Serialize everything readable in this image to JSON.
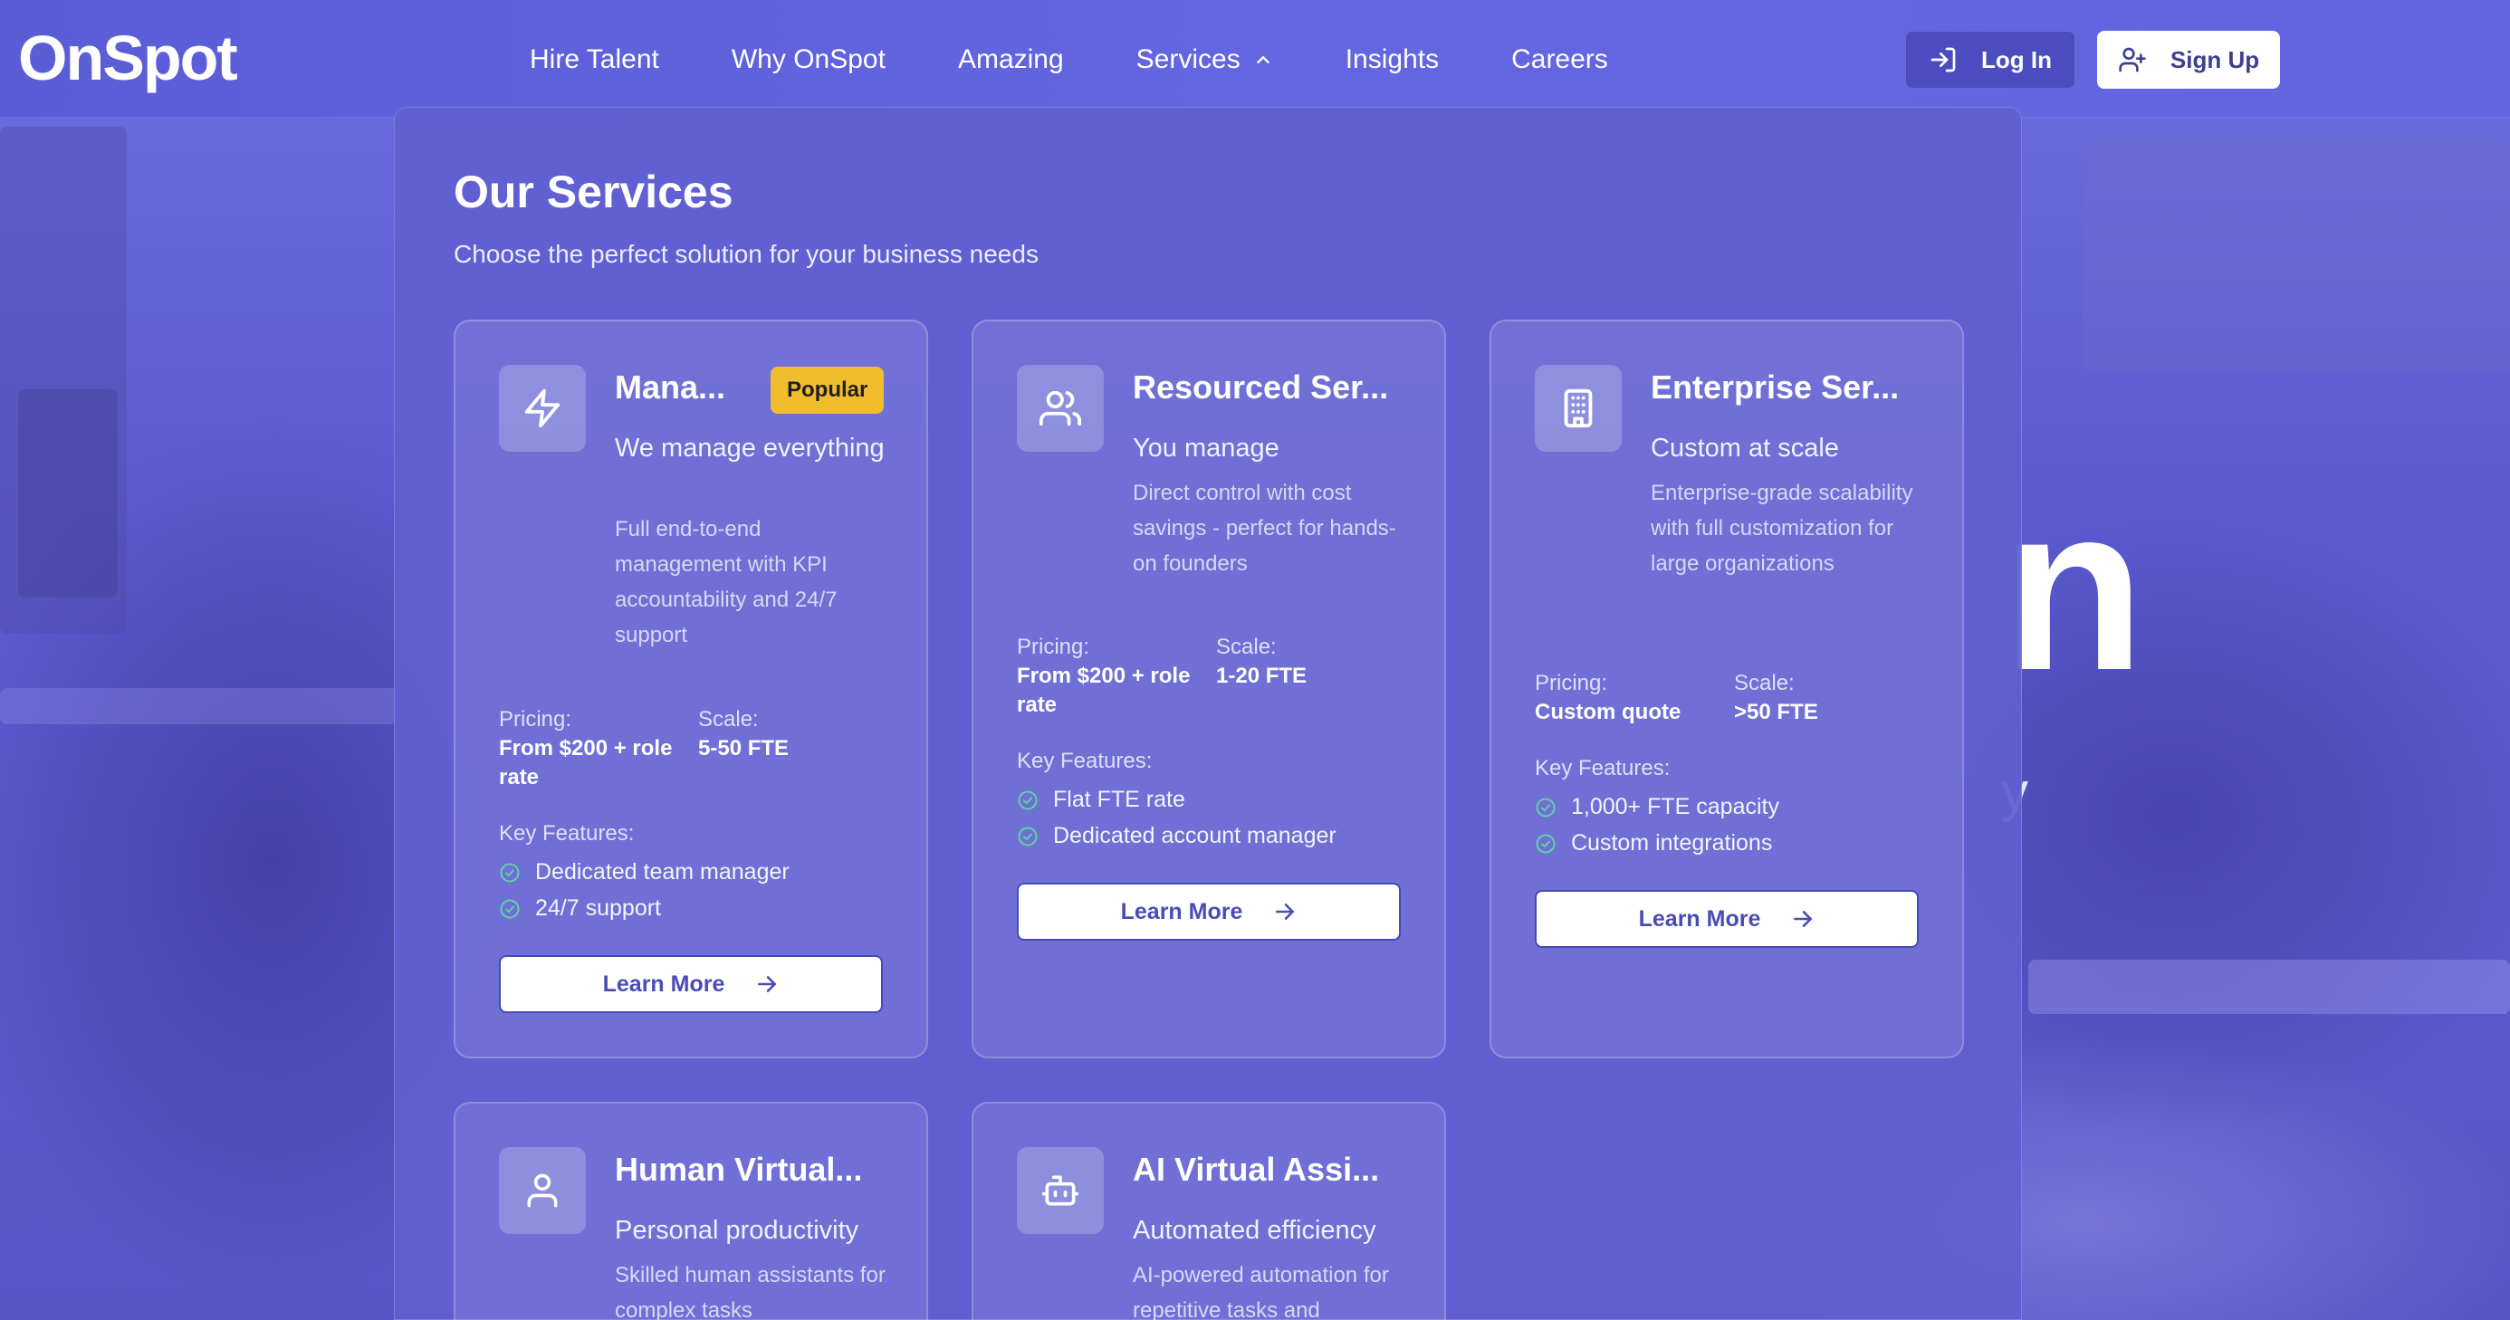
{
  "brand": {
    "logo": "OnSpot"
  },
  "background": {
    "hero_letter": "n",
    "hero_fragment": "y"
  },
  "nav": {
    "links": [
      "Hire Talent",
      "Why OnSpot",
      "Amazing",
      "Services",
      "Insights",
      "Careers"
    ],
    "login_label": "Log In",
    "signup_label": "Sign Up"
  },
  "services": {
    "title": "Our Services",
    "subtitle": "Choose the perfect solution for your business needs",
    "pricing_label": "Pricing:",
    "scale_label": "Scale:",
    "features_label": "Key Features:",
    "learn_more": "Learn More",
    "cards": [
      {
        "title": "Mana...",
        "badge": "Popular",
        "icon": "lightning-icon",
        "tagline": "We manage everything",
        "description": "Full end-to-end management with KPI accountability and 24/7 support",
        "pricing": "From $200 + role rate",
        "scale": "5-50 FTE",
        "features": [
          "Dedicated team manager",
          "24/7 support"
        ]
      },
      {
        "title": "Resourced Ser...",
        "icon": "users-icon",
        "tagline": "You manage",
        "description": "Direct control with cost savings - perfect for hands-on founders",
        "pricing": "From $200 + role rate",
        "scale": "1-20 FTE",
        "features": [
          "Flat FTE rate",
          "Dedicated account manager"
        ]
      },
      {
        "title": "Enterprise Ser...",
        "icon": "building-icon",
        "tagline": "Custom at scale",
        "description": "Enterprise-grade scalability with full customization for large organizations",
        "pricing": "Custom quote",
        "scale": ">50 FTE",
        "features": [
          "1,000+ FTE capacity",
          "Custom integrations"
        ]
      },
      {
        "title": "Human Virtual...",
        "icon": "user-icon",
        "tagline": "Personal productivity",
        "description": "Skilled human assistants for complex tasks"
      },
      {
        "title": "AI Virtual Assi...",
        "icon": "bot-icon",
        "tagline": "Automated efficiency",
        "description": "AI-powered automation for repetitive tasks and"
      }
    ]
  }
}
